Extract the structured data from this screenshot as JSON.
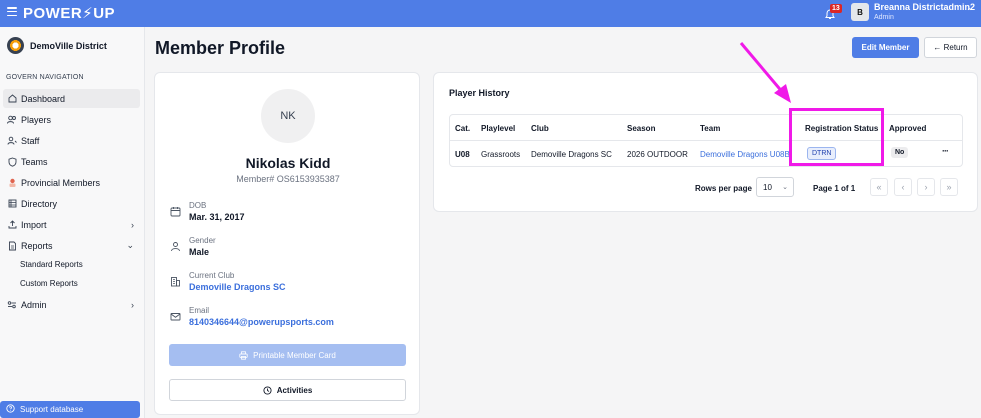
{
  "topbar": {
    "logo": "POWER⚡UP",
    "notification_count": "13",
    "user_initial": "B",
    "user_name": "Breanna Districtadmin2",
    "user_role": "Admin"
  },
  "sidebar": {
    "district": "DemoVille District",
    "nav_title": "GOVERN NAVIGATION",
    "items": [
      {
        "label": "Dashboard",
        "icon": "home-icon"
      },
      {
        "label": "Players",
        "icon": "users-icon"
      },
      {
        "label": "Staff",
        "icon": "staff-icon"
      },
      {
        "label": "Teams",
        "icon": "shield-icon"
      },
      {
        "label": "Provincial Members",
        "icon": "provincial-icon"
      },
      {
        "label": "Directory",
        "icon": "directory-icon"
      },
      {
        "label": "Import",
        "icon": "upload-icon"
      },
      {
        "label": "Reports",
        "icon": "report-icon"
      },
      {
        "label": "Admin",
        "icon": "settings-icon"
      }
    ],
    "sub_items": [
      "Standard Reports",
      "Custom Reports"
    ],
    "support": "Support database"
  },
  "main": {
    "title": "Member Profile",
    "edit_button": "Edit Member",
    "return_button": "← Return"
  },
  "profile": {
    "initials": "NK",
    "name": "Nikolas Kidd",
    "member_number": "Member# OS6153935387",
    "fields": [
      {
        "label": "DOB",
        "value": "Mar. 31, 2017"
      },
      {
        "label": "Gender",
        "value": "Male"
      },
      {
        "label": "Current Club",
        "value": "Demoville Dragons SC"
      },
      {
        "label": "Email",
        "value": "8140346644@powerupsports.com"
      }
    ],
    "print_button": "Printable Member Card",
    "activities_button": "Activities"
  },
  "history": {
    "title": "Player History",
    "columns": [
      "Cat.",
      "Playlevel",
      "Club",
      "Season",
      "Team",
      "Registration Status",
      "Approved"
    ],
    "rows": [
      {
        "cat": "U08",
        "playlevel": "Grassroots",
        "club": "Demoville Dragons SC",
        "season": "2026 OUTDOOR",
        "team": "Demoville Dragons U08B",
        "registration_status": "DTRN",
        "approved": "No",
        "menu": "···"
      }
    ],
    "rows_per_page_label": "Rows per page",
    "rows_per_page_value": "10",
    "page_label": "Page 1 of 1",
    "pager": [
      "«",
      "‹",
      "›",
      "»"
    ]
  },
  "colors": {
    "accent": "#4f7de6",
    "annotation": "#f019e8",
    "link": "#3b6fdc"
  }
}
